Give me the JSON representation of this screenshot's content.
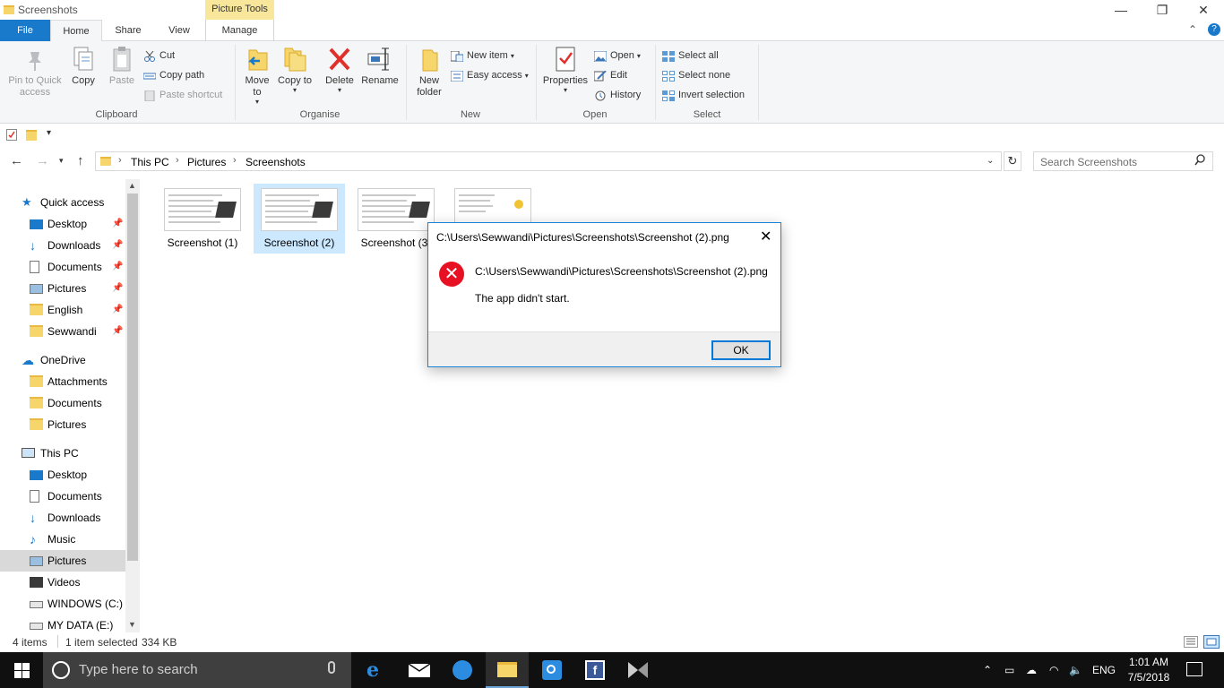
{
  "window": {
    "title": "Screenshots",
    "picture_tools": "Picture Tools",
    "controls": {
      "minimize": "—",
      "maximize": "❐",
      "close": "✕"
    }
  },
  "tabs": {
    "file": "File",
    "home": "Home",
    "share": "Share",
    "view": "View",
    "manage": "Manage"
  },
  "ribbon": {
    "clipboard": {
      "pin": "Pin to Quick access",
      "copy": "Copy",
      "paste": "Paste",
      "cut": "Cut",
      "copy_path": "Copy path",
      "paste_shortcut": "Paste shortcut",
      "label": "Clipboard"
    },
    "organise": {
      "move_to": "Move to",
      "copy_to": "Copy to",
      "delete": "Delete",
      "rename": "Rename",
      "label": "Organise"
    },
    "new": {
      "new_folder": "New folder",
      "new_item": "New item",
      "easy_access": "Easy access",
      "label": "New"
    },
    "open": {
      "properties": "Properties",
      "open": "Open",
      "edit": "Edit",
      "history": "History",
      "label": "Open"
    },
    "select": {
      "select_all": "Select all",
      "select_none": "Select none",
      "invert": "Invert selection",
      "label": "Select"
    }
  },
  "address": {
    "crumbs": [
      "This PC",
      "Pictures",
      "Screenshots"
    ],
    "search_placeholder": "Search Screenshots"
  },
  "nav": {
    "quick_access": "Quick access",
    "qa_items": [
      "Desktop",
      "Downloads",
      "Documents",
      "Pictures",
      "English",
      "Sewwandi"
    ],
    "onedrive": "OneDrive",
    "od_items": [
      "Attachments",
      "Documents",
      "Pictures"
    ],
    "this_pc": "This PC",
    "pc_items": [
      "Desktop",
      "Documents",
      "Downloads",
      "Music",
      "Pictures",
      "Videos",
      "WINDOWS (C:)",
      "MY DATA (E:)"
    ]
  },
  "files": [
    "Screenshot (1)",
    "Screenshot (2)",
    "Screenshot (3)"
  ],
  "dialog": {
    "title": "C:\\Users\\Sewwandi\\Pictures\\Screenshots\\Screenshot (2).png",
    "path": "C:\\Users\\Sewwandi\\Pictures\\Screenshots\\Screenshot (2).png",
    "message": "The app didn't start.",
    "ok": "OK"
  },
  "status": {
    "items": "4 items",
    "selected": "1 item selected",
    "size": "334 KB"
  },
  "taskbar": {
    "search_placeholder": "Type here to search",
    "language": "ENG",
    "time": "1:01 AM",
    "date": "7/5/2018"
  },
  "colors": {
    "accent": "#1979ca",
    "picture_tools": "#f8e79b",
    "selected": "#cce8ff",
    "error": "#e81123",
    "taskbar": "#101010"
  }
}
